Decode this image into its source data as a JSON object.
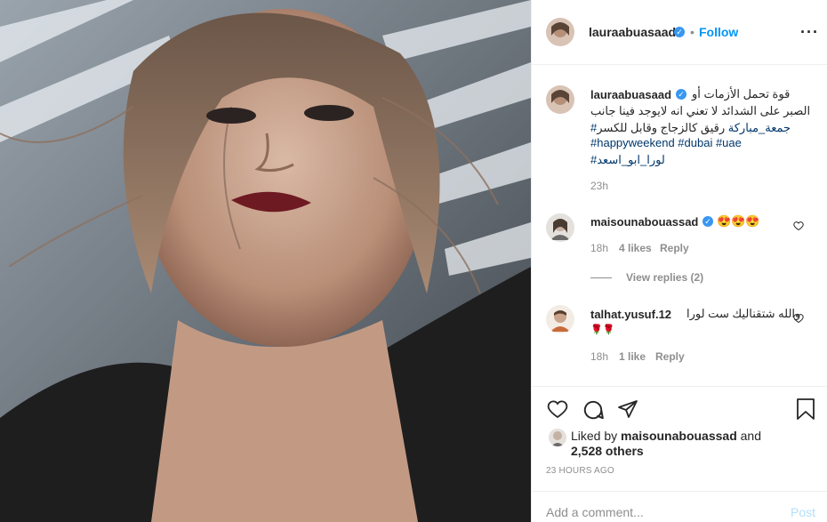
{
  "post": {
    "author": "lauraabuasaad",
    "follow_label": "Follow",
    "more_icon": "more-icon",
    "caption": {
      "line1": "قوة تحمل الأزمات أو",
      "line2": "الصبر على الشدائد لا تعني انه لايوجد فينا جانب",
      "line3a": "رقيق كالزجاج وقابل للكسر",
      "line3b": "#جمعة_مباركة",
      "line4": "#happyweekend #dubai #uae",
      "line5": "#لورا_ابو_اسعد",
      "time": "23h"
    },
    "comments": [
      {
        "user": "maisounabouassad",
        "text": "😍😍😍",
        "time": "18h",
        "likes": "4 likes",
        "reply_label": "Reply",
        "view_replies": "View replies (2)"
      },
      {
        "user": "talhat.yusuf.12",
        "text": "والله شتقناليك ست لورا",
        "text2": "🌹🌹",
        "time": "18h",
        "likes": "1 like",
        "reply_label": "Reply"
      }
    ],
    "liked_by_prefix": "Liked by",
    "liked_by_user": "maisounabouassad",
    "liked_by_and": "and",
    "liked_by_others": "2,528 others",
    "timestamp": "23 HOURS AGO",
    "add_comment_placeholder": "Add a comment...",
    "post_label": "Post"
  },
  "colors": {
    "link": "#0095f6",
    "hashtag": "#00376b",
    "muted": "#8e8e8e"
  }
}
